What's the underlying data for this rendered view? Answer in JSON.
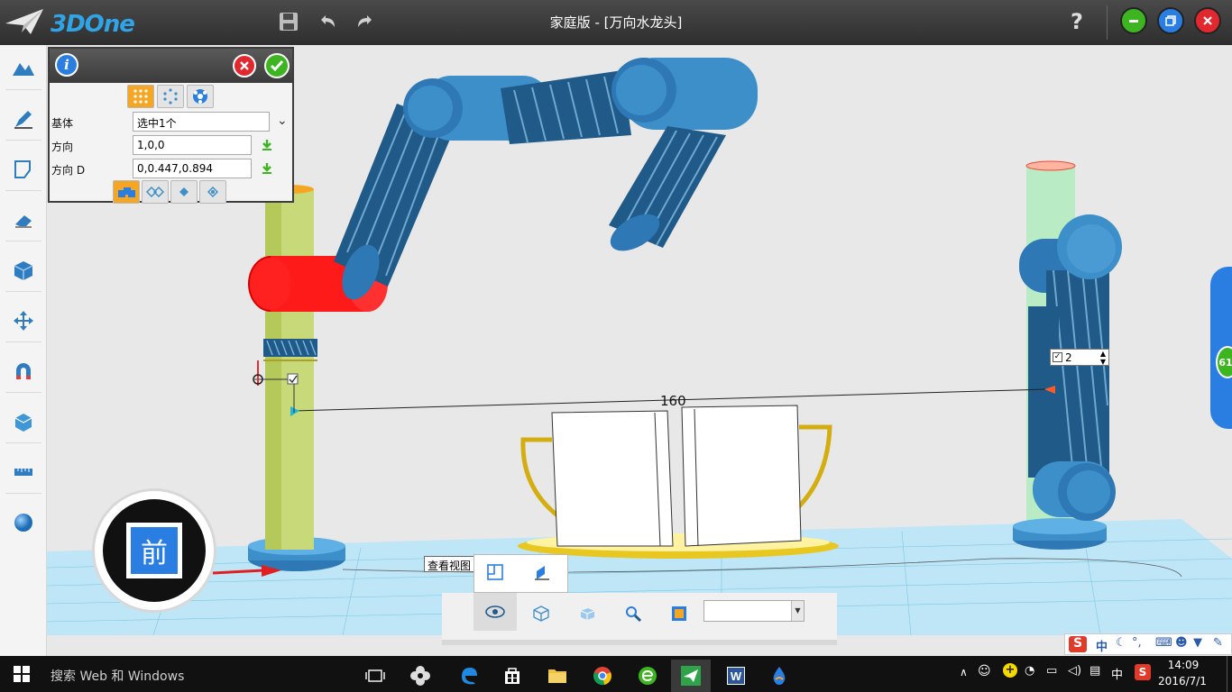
{
  "app": {
    "logo_text": "3DOne",
    "title": "家庭版 - [万向水龙头]",
    "help_label": "?"
  },
  "panel": {
    "rows": [
      {
        "label": "基体",
        "value": "选中1个"
      },
      {
        "label": "方向",
        "value": "1,0,0"
      },
      {
        "label": "方向  D",
        "value": "0,0.447,0.894"
      }
    ]
  },
  "viewport": {
    "dimension_value": "160",
    "spin_value": "2",
    "view_cube_label": "前",
    "edge_badge": "61",
    "view_tooltip": "查看视图"
  },
  "taskbar": {
    "search_placeholder": "搜索 Web 和 Windows",
    "ime_label": "中",
    "time": "14:09",
    "date": "2016/7/1"
  },
  "ime_bar": {
    "lang": "中"
  },
  "colors": {
    "accent": "#2fa4e7",
    "selected_red": "#ff1a1a",
    "pipe_blue": "#3d8fc9",
    "ok_green": "#3cb521"
  }
}
